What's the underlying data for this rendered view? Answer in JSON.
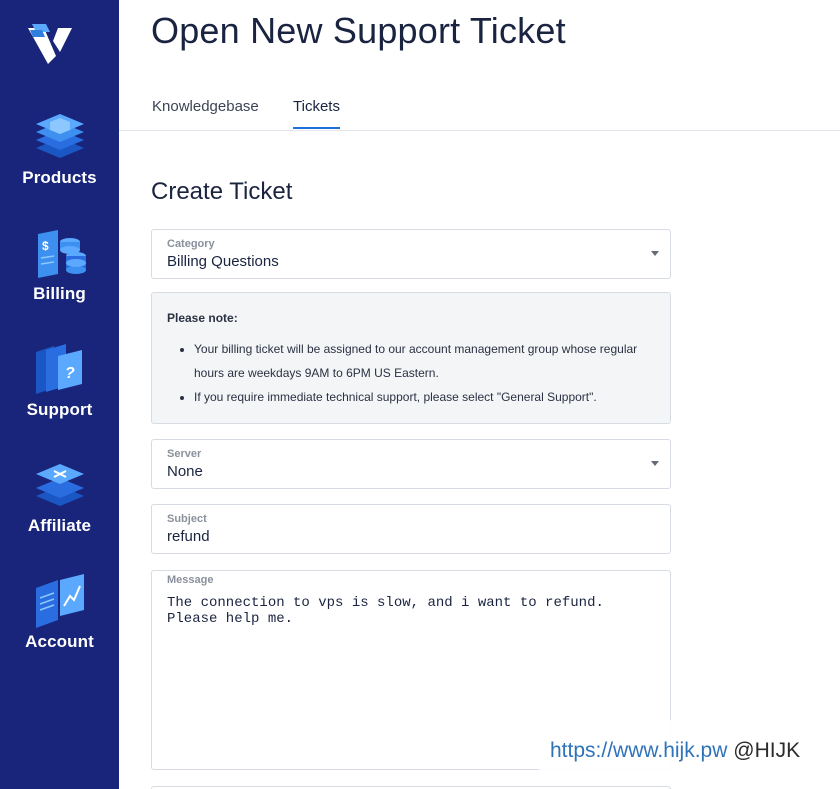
{
  "sidebar": {
    "items": [
      {
        "label": "Products",
        "icon": "products-icon"
      },
      {
        "label": "Billing",
        "icon": "billing-icon"
      },
      {
        "label": "Support",
        "icon": "support-icon"
      },
      {
        "label": "Affiliate",
        "icon": "affiliate-icon"
      },
      {
        "label": "Account",
        "icon": "account-icon"
      }
    ]
  },
  "header": {
    "title": "Open New Support Ticket"
  },
  "tabs": [
    {
      "label": "Knowledgebase"
    },
    {
      "label": "Tickets",
      "active": true
    }
  ],
  "form": {
    "title": "Create Ticket",
    "category": {
      "label": "Category",
      "value": "Billing Questions"
    },
    "note": {
      "title": "Please note:",
      "items": [
        "Your billing ticket will be assigned to our account management group whose regular hours are weekdays 9AM to 6PM US Eastern.",
        "If you require immediate technical support, please select \"General Support\"."
      ]
    },
    "server": {
      "label": "Server",
      "value": "None"
    },
    "subject": {
      "label": "Subject",
      "value": "refund"
    },
    "message": {
      "label": "Message",
      "value": "The connection to vps is slow, and i want to refund.\nPlease help me."
    }
  },
  "watermark": {
    "url": "https://www.hijk.pw",
    "handle": "@HIJK"
  },
  "colors": {
    "sidebar": "#18257a",
    "accent": "#1e6fd9",
    "icon_blue": "#3d8ff0"
  }
}
